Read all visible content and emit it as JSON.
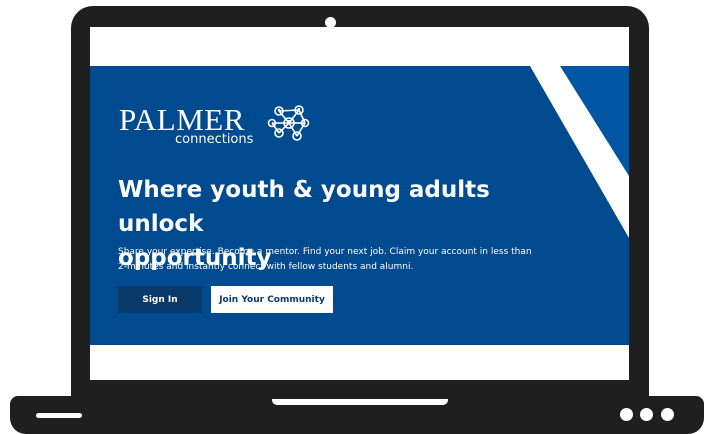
{
  "brand": {
    "name": "PALMER",
    "sub": "connections"
  },
  "hero": {
    "headline_line1": "Where youth & young adults unlock",
    "headline_line2": "opportunity",
    "subtext_line1": "Share your expertise. Become a mentor. Find your next job. Claim your account in less than",
    "subtext_line2": "2-minutes and instantly connect with fellow students and alumni."
  },
  "buttons": {
    "sign_in": "Sign In",
    "join": "Join Your Community"
  },
  "colors": {
    "hero_blue": "#004a8f",
    "button_dark": "#0a3a6a",
    "device": "#1f1f1f"
  },
  "icons": {
    "logo_mark": "network-people-icon",
    "camera": "webcam-dot"
  }
}
